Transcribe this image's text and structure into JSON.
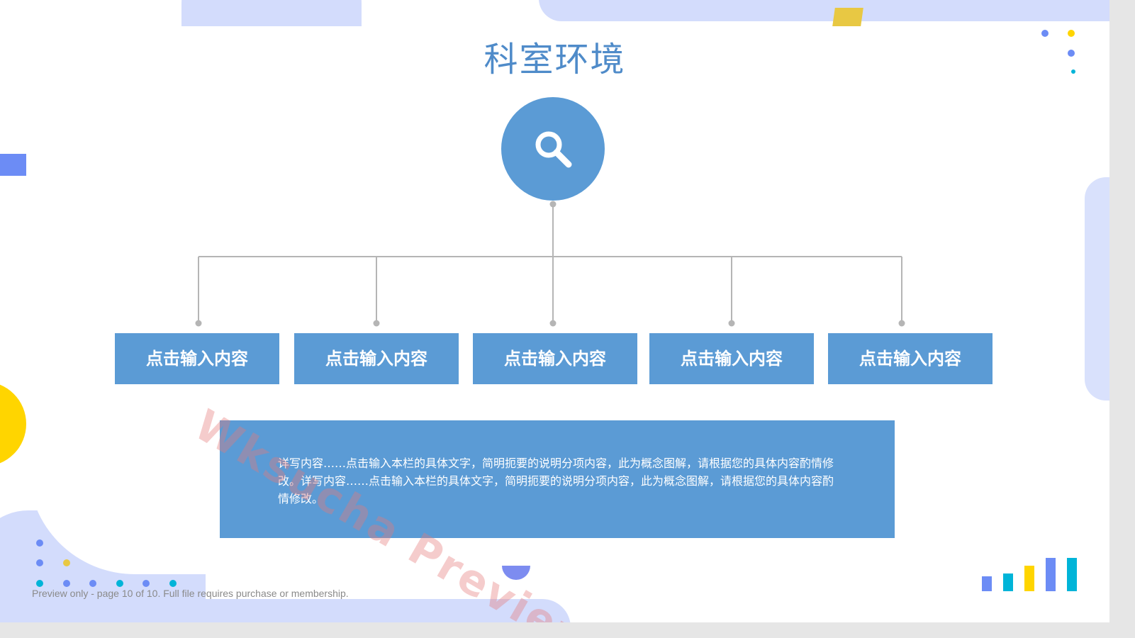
{
  "slide": {
    "title": "科室环境",
    "hub_icon": "search-icon",
    "nodes": [
      {
        "label": "点击输入内容"
      },
      {
        "label": "点击输入内容"
      },
      {
        "label": "点击输入内容"
      },
      {
        "label": "点击输入内容"
      },
      {
        "label": "点击输入内容"
      }
    ],
    "description": "详写内容……点击输入本栏的具体文字，简明扼要的说明分项内容，此为概念图解，请根据您的具体内容酌情修改。详写内容……点击输入本栏的具体文字，简明扼要的说明分项内容，此为概念图解，请根据您的具体内容酌情修改。"
  },
  "watermark": "Wksucha Preview",
  "footer": "Preview only - page 10 of 10. Full file requires purchase or membership.",
  "colors": {
    "accent": "#5b9bd5",
    "title": "#4f8bc9",
    "connector": "#b5b5b5",
    "deco_light": "#d3dcfc",
    "deco_blue": "#6c8cf5",
    "deco_yellow": "#ffd500",
    "deco_cyan": "#00b4d8"
  }
}
